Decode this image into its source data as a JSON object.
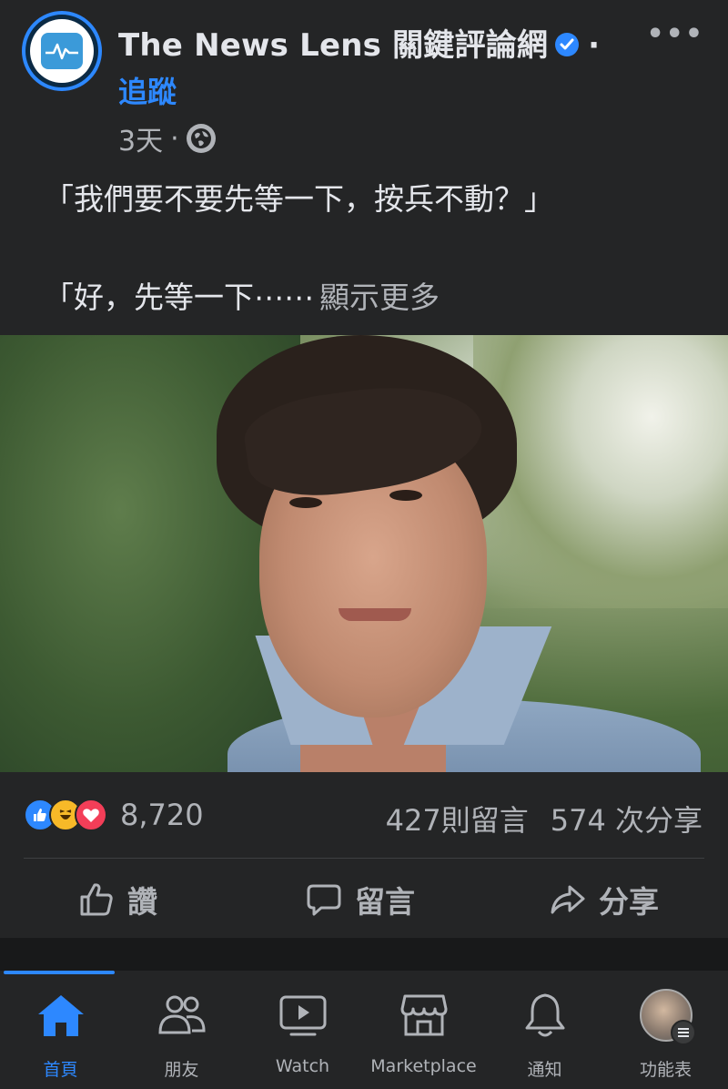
{
  "post": {
    "page_name": "The News Lens 關鍵評論網",
    "follow_label": "追蹤",
    "time_ago": "3天",
    "text_line1": "「我們要不要先等一下，按兵不動？」",
    "text_line2": "「好，先等一下⋯⋯",
    "see_more": "顯示更多"
  },
  "engagement": {
    "reaction_count": "8,720",
    "comments": "427則留言",
    "shares": "574 次分享"
  },
  "actions": {
    "like": "讚",
    "comment": "留言",
    "share": "分享"
  },
  "tabbar": {
    "tabs": [
      {
        "label": "首頁",
        "icon": "home-icon",
        "active": true
      },
      {
        "label": "朋友",
        "icon": "friends-icon"
      },
      {
        "label": "Watch",
        "icon": "watch-icon"
      },
      {
        "label": "Marketplace",
        "icon": "marketplace-icon"
      },
      {
        "label": "通知",
        "icon": "bell-icon"
      },
      {
        "label": "功能表",
        "icon": "menu-icon"
      }
    ]
  },
  "colors": {
    "accent": "#2d88ff",
    "background": "#242526",
    "text_secondary": "#b0b3b8"
  }
}
